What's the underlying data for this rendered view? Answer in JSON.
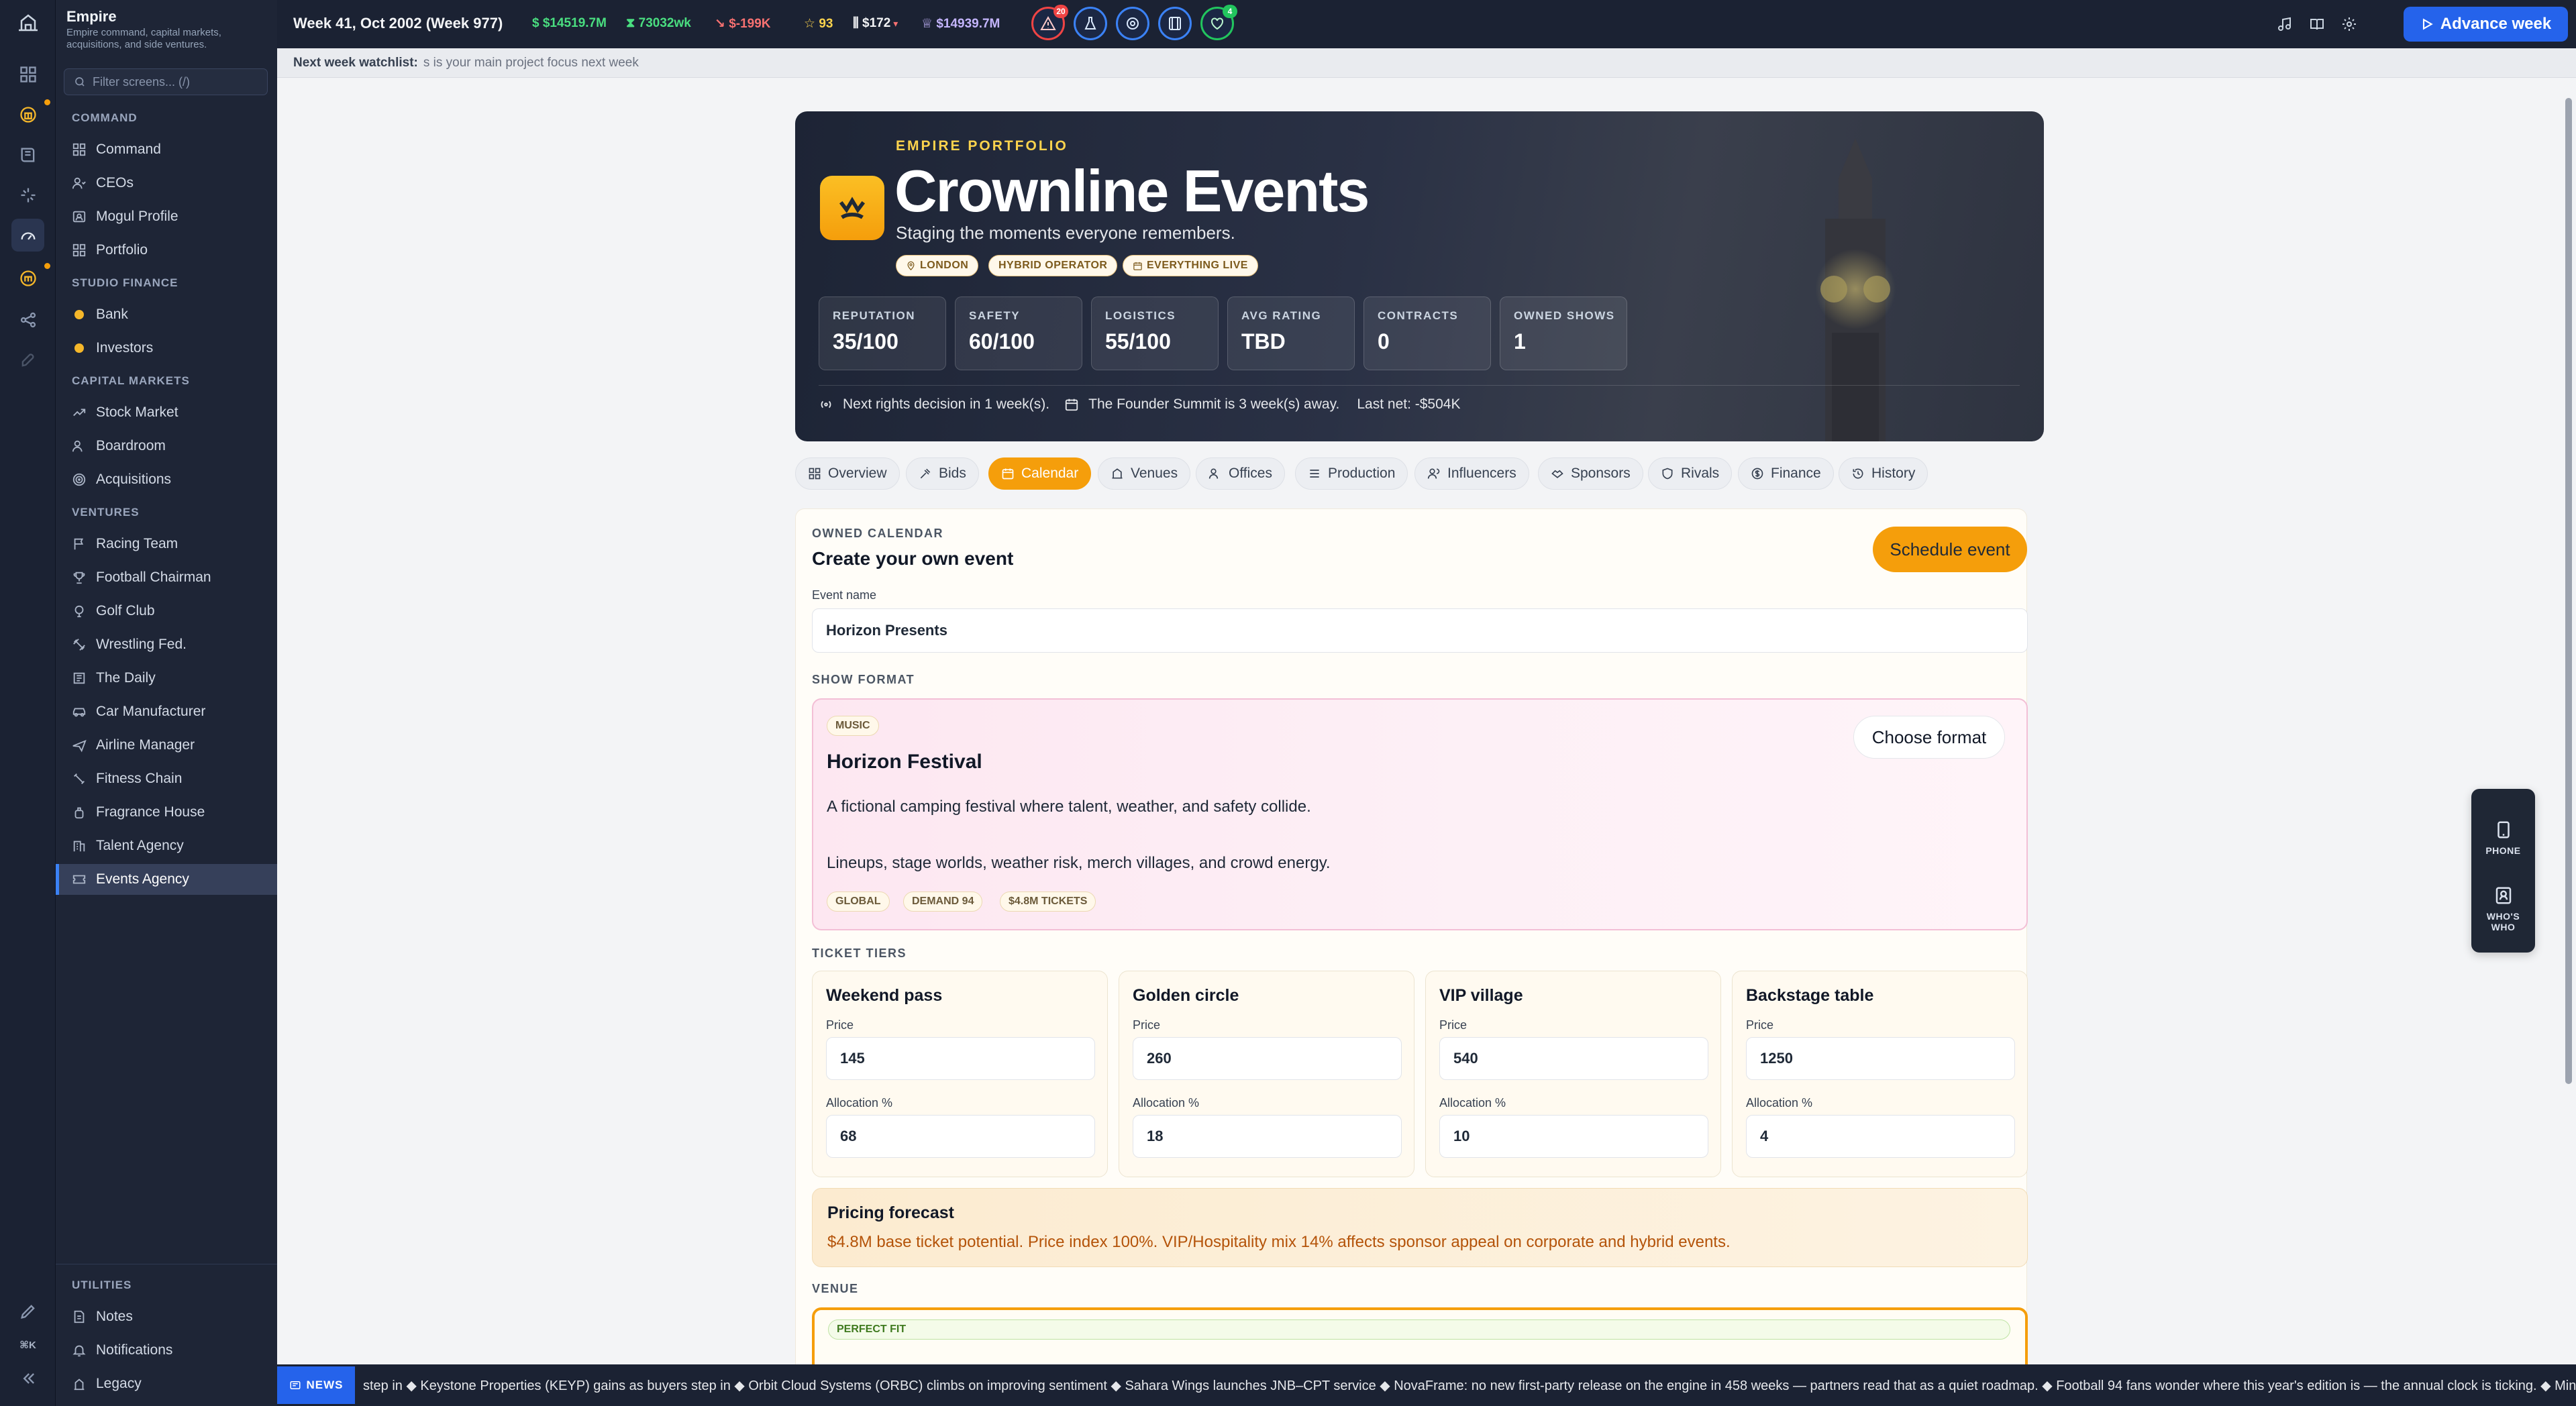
{
  "app": {
    "title": "Empire",
    "subtitle": "Empire command, capital markets, acquisitions, and side ventures."
  },
  "sidebar": {
    "filter_placeholder": "Filter screens... (/)",
    "sections": {
      "command": "COMMAND",
      "studio_finance": "STUDIO FINANCE",
      "capital_markets": "CAPITAL MARKETS",
      "ventures": "VENTURES",
      "utilities": "UTILITIES"
    },
    "command_items": [
      "Command",
      "CEOs",
      "Mogul Profile",
      "Portfolio"
    ],
    "studio_finance_items": [
      "Bank",
      "Investors"
    ],
    "capital_items": [
      "Stock Market",
      "Boardroom",
      "Acquisitions"
    ],
    "venture_items": [
      "Racing Team",
      "Football Chairman",
      "Golf Club",
      "Wrestling Fed.",
      "The Daily",
      "Car Manufacturer",
      "Airline Manager",
      "Fitness Chain",
      "Fragrance House",
      "Talent Agency",
      "Events Agency"
    ],
    "utility_items": [
      "Notes",
      "Notifications",
      "Legacy"
    ],
    "shortcut": "⌘K"
  },
  "topbar": {
    "week": "Week 41, Oct 2002 (Week 977)",
    "cash": "$14519.7M",
    "hours": "73032wk",
    "delta": "$-199K",
    "stars": "93",
    "price": "$172",
    "networth": "$14939.7M",
    "alerts_badge": "20",
    "health_badge": "4",
    "advance_label": "Advance week",
    "colors": {
      "cash": "#4ade80",
      "hours": "#4ade80",
      "delta": "#f87171",
      "networth": "#c4b5fd",
      "accent": "#2563eb"
    }
  },
  "watchlist": {
    "label": "Next week watchlist:",
    "text": "s is your main project focus next week"
  },
  "hero": {
    "kicker": "EMPIRE PORTFOLIO",
    "name": "Crownline Events",
    "tagline": "Staging the moments everyone remembers.",
    "chips": [
      "LONDON",
      "HYBRID OPERATOR",
      "EVERYTHING LIVE"
    ],
    "metrics": [
      {
        "label": "REPUTATION",
        "value": "35/100"
      },
      {
        "label": "SAFETY",
        "value": "60/100"
      },
      {
        "label": "LOGISTICS",
        "value": "55/100"
      },
      {
        "label": "AVG RATING",
        "value": "TBD"
      },
      {
        "label": "CONTRACTS",
        "value": "0"
      },
      {
        "label": "OWNED SHOWS",
        "value": "1"
      }
    ],
    "footer_rights": "Next rights decision in 1 week(s).",
    "footer_summit": "The Founder Summit is 3 week(s) away.",
    "footer_net": "Last net: -$504K"
  },
  "tabs": [
    "Overview",
    "Bids",
    "Calendar",
    "Venues",
    "Offices",
    "Production",
    "Influencers",
    "Sponsors",
    "Rivals",
    "Finance",
    "History"
  ],
  "active_tab": "Calendar",
  "calendar": {
    "kicker": "OWNED CALENDAR",
    "title": "Create your own event",
    "schedule_label": "Schedule event",
    "event_name_label": "Event name",
    "event_name_value": "Horizon Presents",
    "show_format_label": "SHOW FORMAT",
    "format": {
      "genre": "MUSIC",
      "name": "Horizon Festival",
      "desc1": "A fictional camping festival where talent, weather, and safety collide.",
      "desc2": "Lineups, stage worlds, weather risk, merch villages, and crowd energy.",
      "pills": [
        "GLOBAL",
        "DEMAND 94",
        "$4.8M TICKETS"
      ],
      "choose_label": "Choose format"
    },
    "ticket_tiers_label": "TICKET TIERS",
    "price_label": "Price",
    "allocation_label": "Allocation %",
    "tiers": [
      {
        "name": "Weekend pass",
        "price": "145",
        "allocation": "68"
      },
      {
        "name": "Golden circle",
        "price": "260",
        "allocation": "18"
      },
      {
        "name": "VIP village",
        "price": "540",
        "allocation": "10"
      },
      {
        "name": "Backstage table",
        "price": "1250",
        "allocation": "4"
      }
    ],
    "forecast_title": "Pricing forecast",
    "forecast_text": "$4.8M base ticket potential. Price index 100%. VIP/Hospitality mix 14% affects sponsor appeal on corporate and hybrid events.",
    "venue_label": "VENUE",
    "venue_badge": "PERFECT FIT"
  },
  "float_widget": {
    "phone": "PHONE",
    "whos_who": "WHO'S WHO"
  },
  "news": {
    "label": "NEWS",
    "ticker": "step in ◆ Keystone Properties (KEYP) gains as buyers step in ◆ Orbit Cloud Systems (ORBC) climbs on improving sentiment ◆ Sahara Wings launches JNB–CPT service ◆ NovaFrame: no new first-party release on the engine in 458 weeks — partners read that as a quiet roadmap. ◆ Football 94 fans wonder where this year's edition is — the annual clock is ticking. ◆ Minor hardware iss"
  }
}
